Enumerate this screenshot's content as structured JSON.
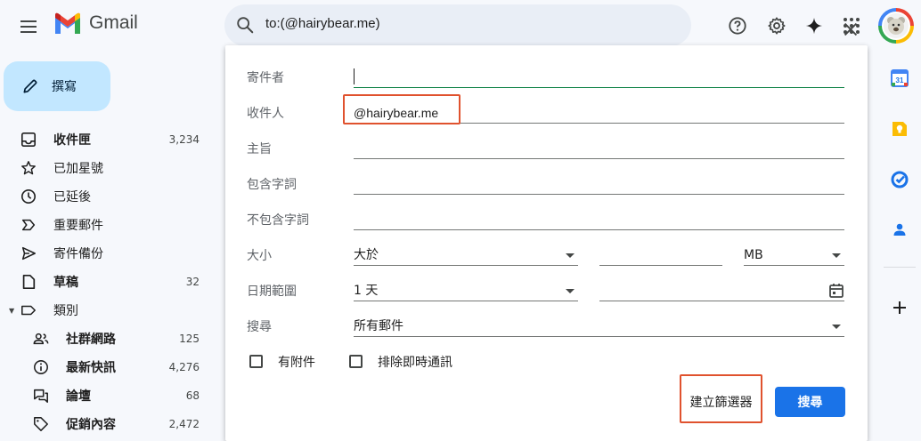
{
  "app": {
    "logo_text": "Gmail"
  },
  "search": {
    "query": "to:(@hairybear.me)"
  },
  "compose": {
    "label": "撰寫"
  },
  "sidebar": {
    "items": [
      {
        "label": "收件匣",
        "count": "3,234",
        "icon": "inbox-icon"
      },
      {
        "label": "已加星號",
        "count": "",
        "icon": "star-icon"
      },
      {
        "label": "已延後",
        "count": "",
        "icon": "clock-icon"
      },
      {
        "label": "重要郵件",
        "count": "",
        "icon": "important-icon"
      },
      {
        "label": "寄件備份",
        "count": "",
        "icon": "send-icon"
      },
      {
        "label": "草稿",
        "count": "32",
        "icon": "draft-icon"
      },
      {
        "label": "類別",
        "count": "",
        "icon": "label-icon"
      },
      {
        "label": "社群網路",
        "count": "125",
        "icon": "people-icon"
      },
      {
        "label": "最新快訊",
        "count": "4,276",
        "icon": "info-icon"
      },
      {
        "label": "論壇",
        "count": "68",
        "icon": "forum-icon"
      },
      {
        "label": "促銷內容",
        "count": "2,472",
        "icon": "tag-icon"
      }
    ]
  },
  "filter_form": {
    "from_label": "寄件者",
    "from_value": "",
    "to_label": "收件人",
    "to_value": "@hairybear.me",
    "subject_label": "主旨",
    "subject_value": "",
    "has_words_label": "包含字詞",
    "has_words_value": "",
    "not_words_label": "不包含字詞",
    "not_words_value": "",
    "size_label": "大小",
    "size_operator": "大於",
    "size_value": "",
    "size_unit": "MB",
    "date_label": "日期範圍",
    "date_range": "1 天",
    "date_value": "",
    "search_in_label": "搜尋",
    "search_in_value": "所有郵件",
    "has_attachment_label": "有附件",
    "exclude_chats_label": "排除即時通訊",
    "create_filter_label": "建立篩選器",
    "search_button_label": "搜尋"
  },
  "colors": {
    "compose_bg": "#c2e7ff",
    "search_button": "#1a73e8",
    "highlight": "#e0522e"
  }
}
